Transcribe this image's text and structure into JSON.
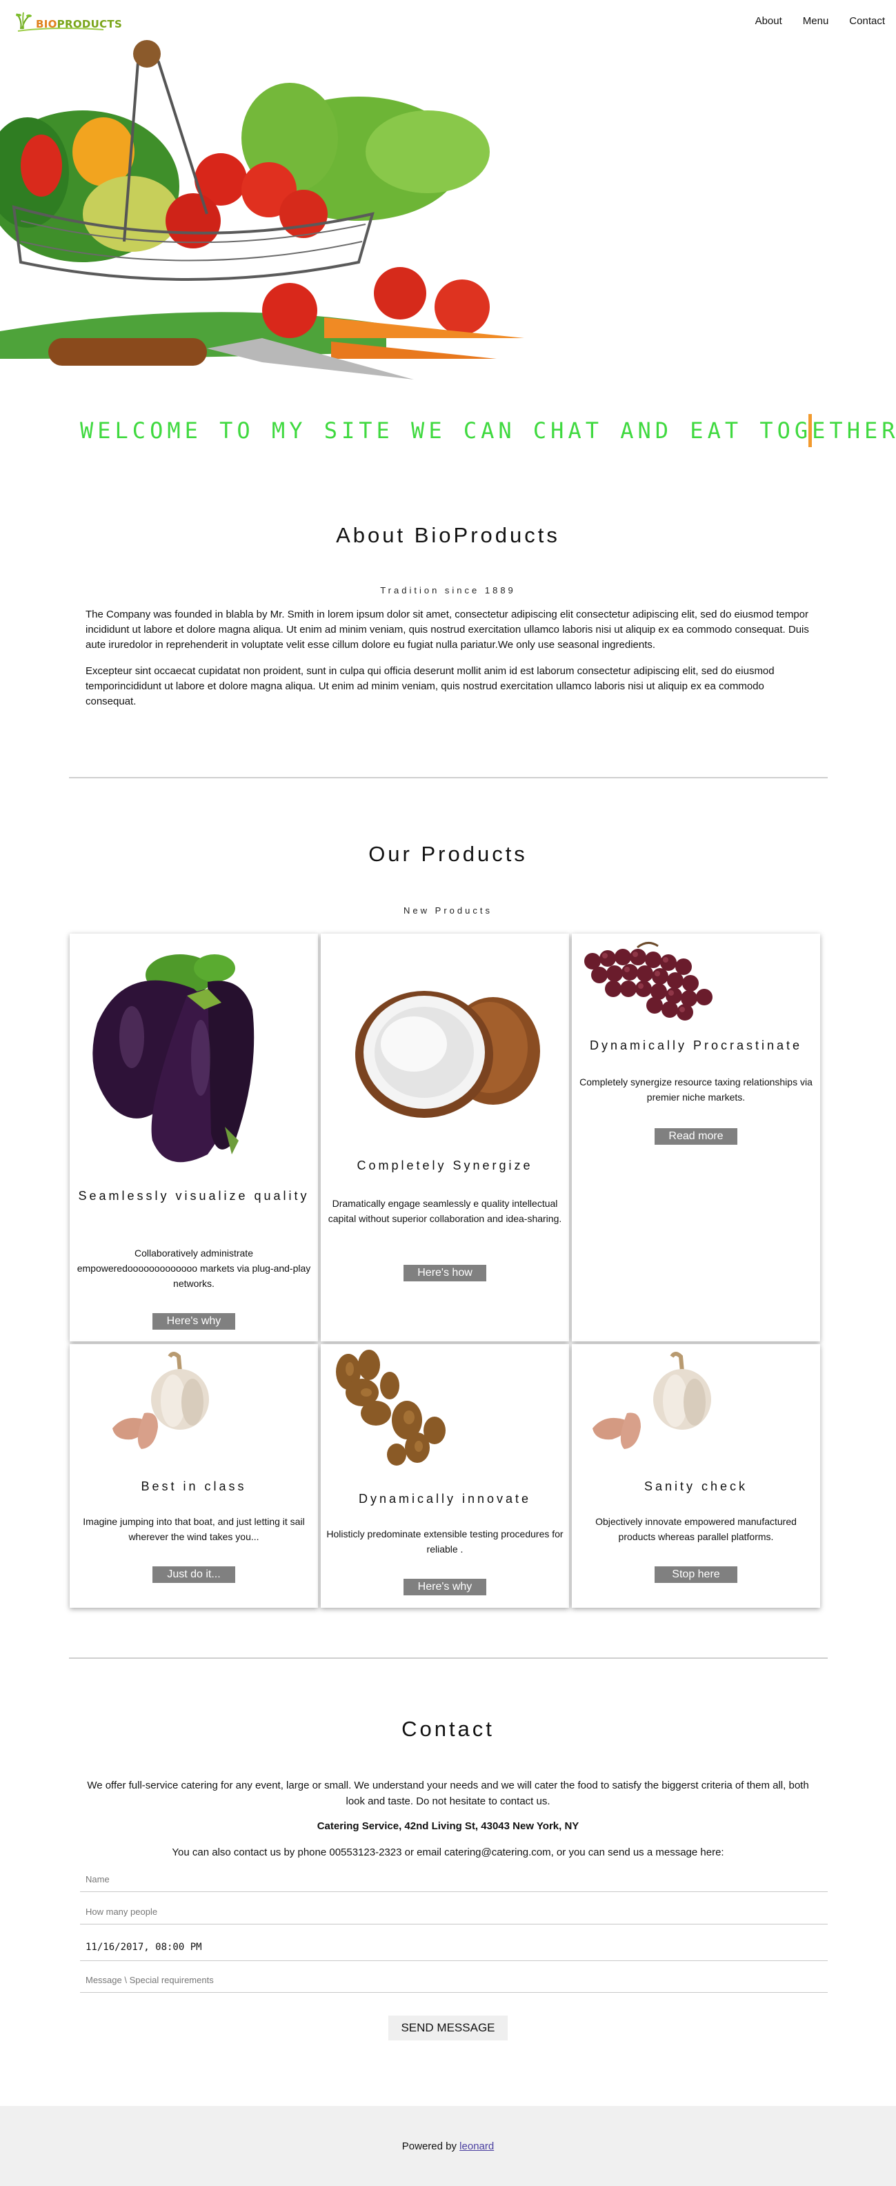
{
  "site": {
    "logo_prefix": "BIO",
    "logo_suffix": "PRODUCTS"
  },
  "nav": [
    {
      "label": "About"
    },
    {
      "label": "Menu"
    },
    {
      "label": "Contact"
    }
  ],
  "hero": {
    "welcome": "WELCOME TO MY SITE WE CAN CHAT AND EAT TOGETHER"
  },
  "about": {
    "title": "About BioProducts",
    "subtitle": "Tradition since 1889",
    "paragraph1": "The Company was founded in blabla by Mr. Smith in lorem ipsum dolor sit amet, consectetur adipiscing elit consectetur adipiscing elit, sed do eiusmod tempor incididunt ut labore et dolore magna aliqua. Ut enim ad minim veniam, quis nostrud exercitation ullamco laboris nisi ut aliquip ex ea commodo consequat. Duis aute iruredolor in reprehenderit in voluptate velit esse cillum dolore eu fugiat nulla pariatur.We only use seasonal ingredients.",
    "paragraph2": "Excepteur sint occaecat cupidatat non proident, sunt in culpa qui officia deserunt mollit anim id est laborum consectetur adipiscing elit, sed do eiusmod temporincididunt ut labore et dolore magna aliqua. Ut enim ad minim veniam, quis nostrud exercitation ullamco laboris nisi ut aliquip ex ea commodo consequat."
  },
  "products": {
    "title": "Our Products",
    "subtitle": "New Products",
    "items": [
      {
        "title": "Seamlessly visualize quality",
        "desc": "Collaboratively administrate empoweredooooooooooooo markets via plug-and-play networks.",
        "button": "Here's why",
        "image_icon": "eggplant-image"
      },
      {
        "title": "Completely Synergize",
        "desc": "Dramatically engage seamlessly e quality intellectual capital without superior collaboration and idea-sharing.",
        "button": "Here's how",
        "image_icon": "coconut-image"
      },
      {
        "title": "Dynamically Procrastinate",
        "desc": "Completely synergize resource taxing relationships via premier niche markets.",
        "button": "Read more",
        "image_icon": "grapes-image"
      },
      {
        "title": "Best in class",
        "desc": "Imagine jumping into that boat, and just letting it sail wherever the wind takes you...",
        "button": "Just do it...",
        "image_icon": "garlic-image"
      },
      {
        "title": "Dynamically innovate",
        "desc": "Holisticly predominate extensible testing procedures for reliable .",
        "button": "Here's why",
        "image_icon": "ginger-image"
      },
      {
        "title": "Sanity check",
        "desc": "Objectively innovate empowered manufactured products whereas parallel platforms.",
        "button": "Stop here",
        "image_icon": "garlic-image"
      }
    ]
  },
  "contact": {
    "title": "Contact",
    "intro": "We offer full-service catering for any event, large or small. We understand your needs and we will cater the food to satisfy the biggerst criteria of them all, both look and taste. Do not hesitate to contact us.",
    "address": "Catering Service, 42nd Living St, 43043 New York, NY",
    "phone_line": "You can also contact us by phone 00553123-2323 or email catering@catering.com, or you can send us a message here:",
    "name_placeholder": "Name",
    "people_placeholder": "How many people",
    "datetime_value": "11/16/2017, 08:00 PM",
    "message_placeholder": "Message \\ Special requirements",
    "send_label": "SEND MESSAGE"
  },
  "footer": {
    "powered_by": "Powered by",
    "link_label": "leonard"
  },
  "colors": {
    "welcome": "#3fd93f",
    "cursor": "#f29a2e",
    "button": "#808080",
    "footer_bg": "#f0f0f0"
  }
}
